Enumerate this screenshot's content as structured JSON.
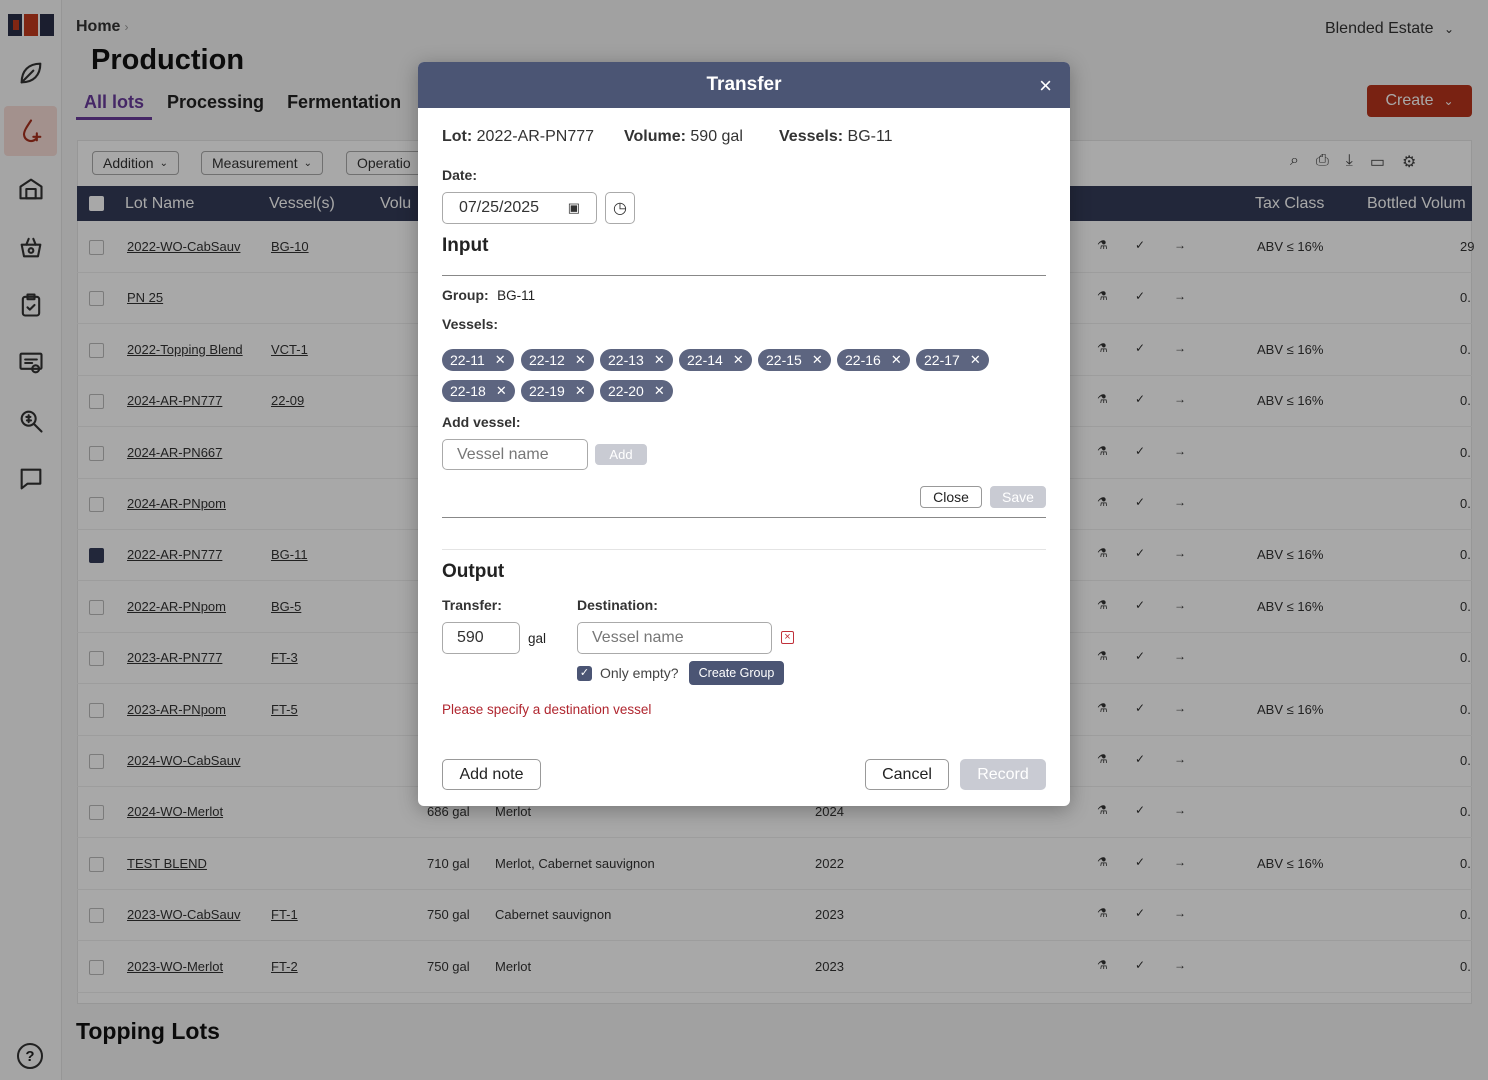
{
  "app": {
    "estate": "Blended Estate"
  },
  "breadcrumb": {
    "home": "Home",
    "sep": "›"
  },
  "page": {
    "title": "Production",
    "create_label": "Create"
  },
  "tabs": [
    "All lots",
    "Processing",
    "Fermentation"
  ],
  "filters": [
    "Addition",
    "Measurement",
    "Operatio"
  ],
  "table": {
    "headers": {
      "lot": "Lot Name",
      "vessel": "Vessel(s)",
      "volume": "Volu",
      "tax": "Tax Class",
      "bottled": "Bottled Volum"
    },
    "rows": [
      {
        "lot": "2022-WO-CabSauv",
        "vessel": "BG-10",
        "vol": "",
        "var": "",
        "vint": "",
        "tax": "ABV ≤ 16%",
        "bot": "29",
        "checked": false
      },
      {
        "lot": "PN 25",
        "vessel": "",
        "vol": "",
        "var": "",
        "vint": "",
        "tax": "",
        "bot": "0.",
        "checked": false
      },
      {
        "lot": "2022-Topping Blend",
        "vessel": "VCT-1",
        "vol": "",
        "var": "",
        "vint": "",
        "tax": "ABV ≤ 16%",
        "bot": "0.",
        "checked": false
      },
      {
        "lot": "2024-AR-PN777",
        "vessel": "22-09",
        "vol": "",
        "var": "",
        "vint": "",
        "tax": "ABV ≤ 16%",
        "bot": "0.",
        "checked": false
      },
      {
        "lot": "2024-AR-PN667",
        "vessel": "",
        "vol": "",
        "var": "",
        "vint": "",
        "tax": "",
        "bot": "0.",
        "checked": false
      },
      {
        "lot": "2024-AR-PNpom",
        "vessel": "",
        "vol": "",
        "var": "",
        "vint": "",
        "tax": "",
        "bot": "0.",
        "checked": false
      },
      {
        "lot": "2022-AR-PN777",
        "vessel": "BG-11",
        "vol": "",
        "var": "",
        "vint": "",
        "tax": "ABV ≤ 16%",
        "bot": "0.",
        "checked": true
      },
      {
        "lot": "2022-AR-PNpom",
        "vessel": "BG-5",
        "vol": "",
        "var": "",
        "vint": "",
        "tax": "ABV ≤ 16%",
        "bot": "0.",
        "checked": false
      },
      {
        "lot": "2023-AR-PN777",
        "vessel": "FT-3",
        "vol": "",
        "var": "",
        "vint": "",
        "tax": "",
        "bot": "0.",
        "checked": false
      },
      {
        "lot": "2023-AR-PNpom",
        "vessel": "FT-5",
        "vol": "",
        "var": "",
        "vint": "",
        "tax": "ABV ≤ 16%",
        "bot": "0.",
        "checked": false
      },
      {
        "lot": "2024-WO-CabSauv",
        "vessel": "",
        "vol": "",
        "var": "",
        "vint": "",
        "tax": "",
        "bot": "0.",
        "checked": false
      },
      {
        "lot": "2024-WO-Merlot",
        "vessel": "",
        "vol": "686 gal",
        "var": "Merlot",
        "vint": "2024",
        "tax": "",
        "bot": "0.",
        "checked": false
      },
      {
        "lot": "TEST BLEND",
        "vessel": "",
        "vol": "710 gal",
        "var": "Merlot, Cabernet sauvignon",
        "vint": "2022",
        "tax": "ABV ≤ 16%",
        "bot": "0.",
        "checked": false
      },
      {
        "lot": "2023-WO-CabSauv",
        "vessel": "FT-1",
        "vol": "750 gal",
        "var": "Cabernet sauvignon",
        "vint": "2023",
        "tax": "",
        "bot": "0.",
        "checked": false
      },
      {
        "lot": "2023-WO-Merlot",
        "vessel": "FT-2",
        "vol": "750 gal",
        "var": "Merlot",
        "vint": "2023",
        "tax": "",
        "bot": "0.",
        "checked": false
      }
    ]
  },
  "topping": {
    "title": "Topping Lots"
  },
  "modal": {
    "title": "Transfer",
    "close_icon": "×",
    "lot_label": "Lot:",
    "lot_value": "2022-AR-PN777",
    "volume_label": "Volume:",
    "volume_value": "590 gal",
    "vessels_label": "Vessels:",
    "vessels_value": "BG-11",
    "date_label": "Date:",
    "date_value": "07/25/2025",
    "input_title": "Input",
    "group_label": "Group:",
    "group_value": "BG-11",
    "vessels_list_label": "Vessels:",
    "chips": [
      "22-11",
      "22-12",
      "22-13",
      "22-14",
      "22-15",
      "22-16",
      "22-17",
      "22-18",
      "22-19",
      "22-20"
    ],
    "add_vessel_label": "Add vessel:",
    "vessel_placeholder": "Vessel name",
    "add_label": "Add",
    "close_label": "Close",
    "save_label": "Save",
    "output_title": "Output",
    "transfer_label": "Transfer:",
    "transfer_value": "590",
    "transfer_unit": "gal",
    "destination_label": "Destination:",
    "destination_placeholder": "Vessel name",
    "only_empty_label": "Only empty?",
    "create_group_label": "Create Group",
    "error_text": "Please specify a destination vessel",
    "add_note_label": "Add note",
    "cancel_label": "Cancel",
    "record_label": "Record"
  },
  "colors": {
    "accent": "#b8341c",
    "header": "#343c58",
    "modal_header": "#4b5574",
    "tab_active": "#6a3c9c",
    "error": "#b0262f"
  }
}
